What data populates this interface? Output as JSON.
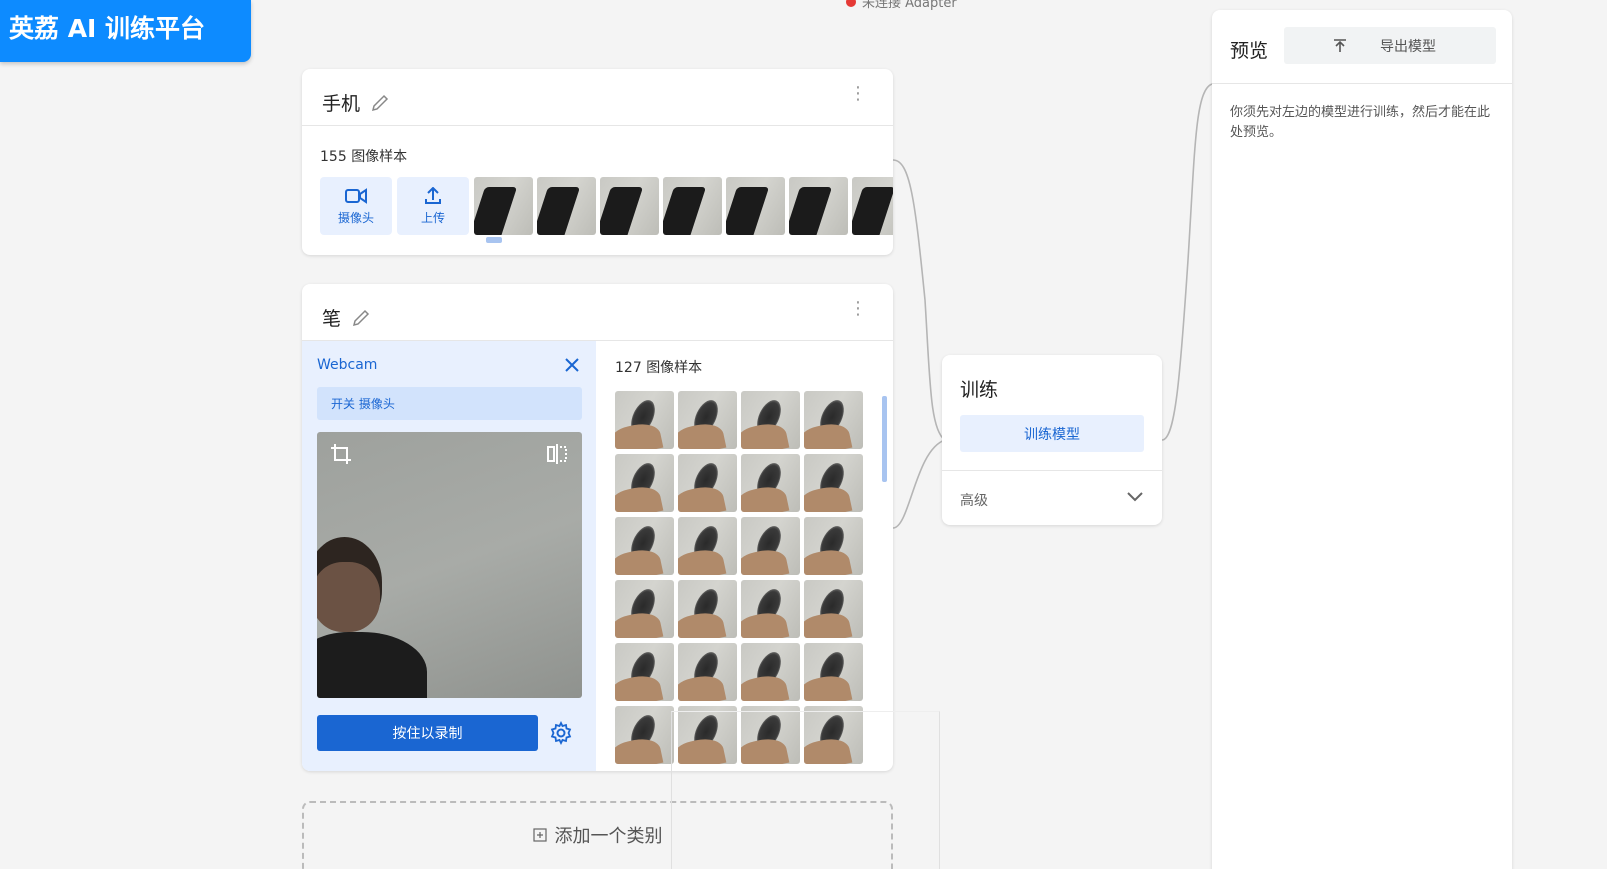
{
  "app": {
    "title": "英荔 AI 训练平台"
  },
  "status": {
    "text": "未连接 Adapter",
    "color": "#e53935"
  },
  "class1": {
    "name": "手机",
    "samples_count": "155",
    "samples_suffix": "图像样本",
    "webcam_label": "摄像头",
    "upload_label": "上传",
    "thumbnails": 7
  },
  "class2": {
    "name": "笔",
    "webcam_title": "Webcam",
    "toggle_label": "开关 摄像头",
    "record_label": "按住以录制",
    "samples_count": "127",
    "samples_suffix": "图像样本",
    "thumbnails": 24
  },
  "add_class": {
    "label": "添加一个类别"
  },
  "training": {
    "title": "训练",
    "train_button": "训练模型",
    "advanced": "高级"
  },
  "preview": {
    "title": "预览",
    "export_button": "导出模型",
    "message": "你须先对左边的模型进行训练，然后才能在此处预览。"
  },
  "colors": {
    "accent": "#1a66d2",
    "logo_bg": "#0d8bff",
    "light": "#e8f0fe"
  }
}
